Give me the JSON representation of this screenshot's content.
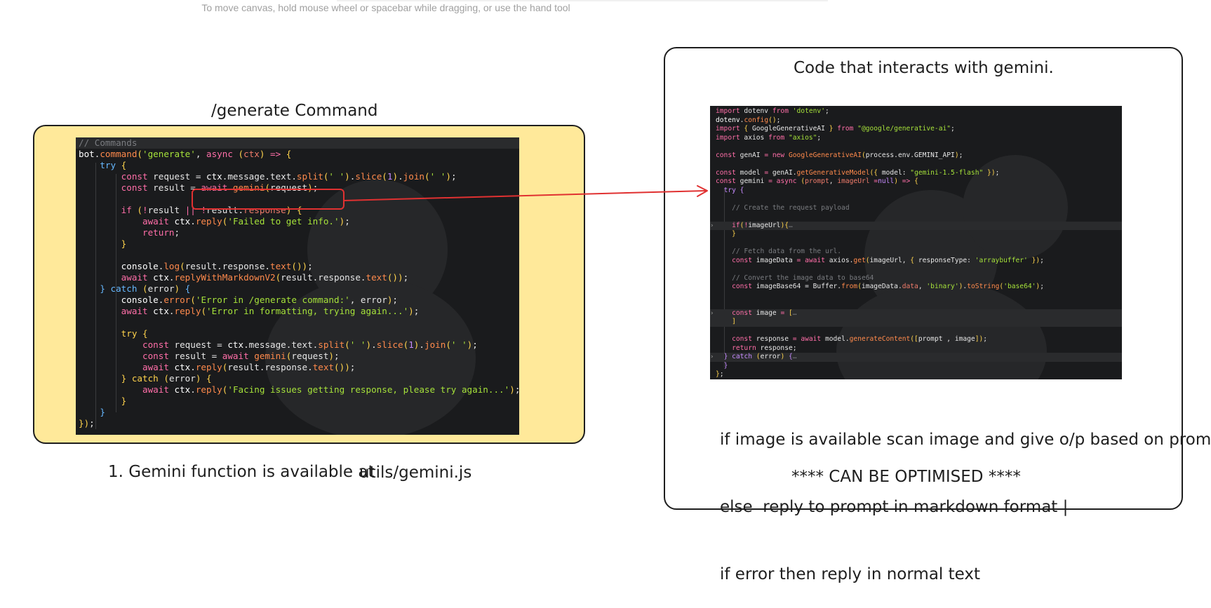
{
  "canvas_hint": "To move canvas, hold mouse wheel or spacebar while dragging, or use the hand tool",
  "left_title": "/generate Command",
  "left_note": "1. Gemini function is available at",
  "left_note_path": "utils/gemini.js",
  "right_title": "Code that interacts with gemini.",
  "right_notes": [
    "if image is available scan image and give o/p based on prompt",
    "else  reply to prompt in markdown format |",
    "if error then reply in normal text"
  ],
  "right_footer": "**** CAN BE OPTIMISED ****",
  "colors": {
    "frame_fill": "#ffe99a",
    "arrow": "#e03131",
    "code_bg": "#1a1b1d"
  },
  "left_code": [
    [
      [
        "c",
        "// Commands"
      ]
    ],
    [
      [
        "v",
        "bot"
      ],
      [
        "",
        "."
      ],
      [
        "f",
        "command"
      ],
      [
        "p",
        "("
      ],
      [
        "s",
        "'generate'"
      ],
      [
        "",
        ", "
      ],
      [
        "k",
        "async"
      ],
      [
        "p",
        " ("
      ],
      [
        "pr",
        "ctx"
      ],
      [
        "p",
        ")"
      ],
      [
        "k",
        " => "
      ],
      [
        "p",
        "{"
      ]
    ],
    [
      [
        "",
        "    "
      ],
      [
        "b",
        "try"
      ],
      [
        "p",
        " {"
      ]
    ],
    [
      [
        "",
        "        "
      ],
      [
        "k",
        "const"
      ],
      [
        "",
        " request = "
      ],
      [
        "v",
        "ctx"
      ],
      [
        "",
        ".message.text."
      ],
      [
        "f",
        "split"
      ],
      [
        "p",
        "("
      ],
      [
        "s",
        "' '"
      ],
      [
        "p",
        ")"
      ],
      [
        "",
        "."
      ],
      [
        "f",
        "slice"
      ],
      [
        "p",
        "("
      ],
      [
        "pu",
        "1"
      ],
      [
        "p",
        ")"
      ],
      [
        "",
        "."
      ],
      [
        "f",
        "join"
      ],
      [
        "p",
        "("
      ],
      [
        "s",
        "' '"
      ],
      [
        "p",
        ")"
      ],
      [
        "",
        ";"
      ]
    ],
    [
      [
        "",
        "        "
      ],
      [
        "k",
        "const"
      ],
      [
        "",
        " result = "
      ],
      [
        "k",
        "await "
      ],
      [
        "f",
        "gemini"
      ],
      [
        "p",
        "("
      ],
      [
        "",
        "request"
      ],
      [
        "p",
        ")"
      ],
      [
        "",
        ";"
      ]
    ],
    [
      [
        "",
        ""
      ]
    ],
    [
      [
        "",
        "        "
      ],
      [
        "k",
        "if"
      ],
      [
        "p",
        " ("
      ],
      [
        "k",
        "!"
      ],
      [
        "",
        "result "
      ],
      [
        "k",
        "||"
      ],
      [
        "k",
        " !"
      ],
      [
        "",
        "result."
      ],
      [
        "pr",
        "response"
      ],
      [
        "p",
        ")"
      ],
      [
        "p",
        " {"
      ]
    ],
    [
      [
        "",
        "            "
      ],
      [
        "k",
        "await "
      ],
      [
        "v",
        "ctx"
      ],
      [
        "",
        "."
      ],
      [
        "f",
        "reply"
      ],
      [
        "p",
        "("
      ],
      [
        "s",
        "'Failed to get info.'"
      ],
      [
        "p",
        ")"
      ],
      [
        "",
        ";"
      ]
    ],
    [
      [
        "",
        "            "
      ],
      [
        "k",
        "return"
      ],
      [
        "",
        ";"
      ]
    ],
    [
      [
        "",
        "        "
      ],
      [
        "p",
        "}"
      ]
    ],
    [
      [
        "",
        ""
      ]
    ],
    [
      [
        "",
        "        "
      ],
      [
        "v",
        "console"
      ],
      [
        "",
        "."
      ],
      [
        "f",
        "log"
      ],
      [
        "p",
        "("
      ],
      [
        "",
        "result.response."
      ],
      [
        "f",
        "text"
      ],
      [
        "p",
        "()"
      ],
      [
        "p",
        ")"
      ],
      [
        "",
        ";"
      ]
    ],
    [
      [
        "",
        "        "
      ],
      [
        "k",
        "await "
      ],
      [
        "v",
        "ctx"
      ],
      [
        "",
        "."
      ],
      [
        "f",
        "replyWithMarkdownV2"
      ],
      [
        "p",
        "("
      ],
      [
        "",
        "result.response."
      ],
      [
        "f",
        "text"
      ],
      [
        "p",
        "()"
      ],
      [
        "p",
        ")"
      ],
      [
        "",
        ";"
      ]
    ],
    [
      [
        "",
        "    "
      ],
      [
        "b",
        "}"
      ],
      [
        "b",
        " catch"
      ],
      [
        "p",
        " ("
      ],
      [
        "",
        "error"
      ],
      [
        "p",
        ")"
      ],
      [
        "b",
        " {"
      ]
    ],
    [
      [
        "",
        "        "
      ],
      [
        "v",
        "console"
      ],
      [
        "",
        "."
      ],
      [
        "f",
        "error"
      ],
      [
        "p",
        "("
      ],
      [
        "s",
        "'Error in /generate command:'"
      ],
      [
        "",
        ", error"
      ],
      [
        "p",
        ")"
      ],
      [
        "",
        ";"
      ]
    ],
    [
      [
        "",
        "        "
      ],
      [
        "k",
        "await "
      ],
      [
        "v",
        "ctx"
      ],
      [
        "",
        "."
      ],
      [
        "f",
        "reply"
      ],
      [
        "p",
        "("
      ],
      [
        "s",
        "'Error in formatting, trying again...'"
      ],
      [
        "p",
        ")"
      ],
      [
        "",
        ";"
      ]
    ],
    [
      [
        "",
        ""
      ]
    ],
    [
      [
        "",
        "        "
      ],
      [
        "p",
        "try"
      ],
      [
        "p",
        " {"
      ]
    ],
    [
      [
        "",
        "            "
      ],
      [
        "k",
        "const"
      ],
      [
        "",
        " request = "
      ],
      [
        "v",
        "ctx"
      ],
      [
        "",
        ".message.text."
      ],
      [
        "f",
        "split"
      ],
      [
        "p",
        "("
      ],
      [
        "s",
        "' '"
      ],
      [
        "p",
        ")"
      ],
      [
        "",
        "."
      ],
      [
        "f",
        "slice"
      ],
      [
        "p",
        "("
      ],
      [
        "pu",
        "1"
      ],
      [
        "p",
        ")"
      ],
      [
        "",
        "."
      ],
      [
        "f",
        "join"
      ],
      [
        "p",
        "("
      ],
      [
        "s",
        "' '"
      ],
      [
        "p",
        ")"
      ],
      [
        "",
        ";"
      ]
    ],
    [
      [
        "",
        "            "
      ],
      [
        "k",
        "const"
      ],
      [
        "",
        " result = "
      ],
      [
        "k",
        "await "
      ],
      [
        "f",
        "gemini"
      ],
      [
        "p",
        "("
      ],
      [
        "",
        "request"
      ],
      [
        "p",
        ")"
      ],
      [
        "",
        ";"
      ]
    ],
    [
      [
        "",
        "            "
      ],
      [
        "k",
        "await "
      ],
      [
        "v",
        "ctx"
      ],
      [
        "",
        "."
      ],
      [
        "f",
        "reply"
      ],
      [
        "p",
        "("
      ],
      [
        "",
        "result.response."
      ],
      [
        "f",
        "text"
      ],
      [
        "p",
        "()"
      ],
      [
        "p",
        ")"
      ],
      [
        "",
        ";"
      ]
    ],
    [
      [
        "",
        "        "
      ],
      [
        "p",
        "}"
      ],
      [
        "p",
        " catch"
      ],
      [
        "p",
        " ("
      ],
      [
        "",
        "error"
      ],
      [
        "p",
        ")"
      ],
      [
        "p",
        " {"
      ]
    ],
    [
      [
        "",
        "            "
      ],
      [
        "k",
        "await "
      ],
      [
        "v",
        "ctx"
      ],
      [
        "",
        "."
      ],
      [
        "f",
        "reply"
      ],
      [
        "p",
        "("
      ],
      [
        "s",
        "'Facing issues getting response, please try again...'"
      ],
      [
        "p",
        ")"
      ],
      [
        "",
        ";"
      ]
    ],
    [
      [
        "",
        "        "
      ],
      [
        "p",
        "}"
      ]
    ],
    [
      [
        "",
        "    "
      ],
      [
        "b",
        "}"
      ]
    ],
    [
      [
        "p",
        "})"
      ],
      [
        "",
        ";"
      ]
    ]
  ],
  "right_code": [
    [
      [
        "k",
        "import"
      ],
      [
        "",
        " dotenv "
      ],
      [
        "k",
        "from"
      ],
      [
        "s",
        " 'dotenv'"
      ],
      [
        "",
        ";"
      ]
    ],
    [
      [
        "v",
        "dotenv"
      ],
      [
        "",
        "."
      ],
      [
        "f",
        "config"
      ],
      [
        "p",
        "()"
      ],
      [
        "",
        ";"
      ]
    ],
    [
      [
        "k",
        "import"
      ],
      [
        "p",
        " { "
      ],
      [
        "",
        "GoogleGenerativeAI "
      ],
      [
        "p",
        "}"
      ],
      [
        "k",
        " from"
      ],
      [
        "s",
        " \"@google/generative-ai\""
      ],
      [
        "",
        ";"
      ]
    ],
    [
      [
        "k",
        "import"
      ],
      [
        "",
        " axios "
      ],
      [
        "k",
        "from"
      ],
      [
        "s",
        " \"axios\""
      ],
      [
        "",
        ";"
      ]
    ],
    [
      [
        "",
        ""
      ]
    ],
    [
      [
        "k",
        "const"
      ],
      [
        "",
        " genAI "
      ],
      [
        "k",
        "="
      ],
      [
        "k",
        " new "
      ],
      [
        "f",
        "GoogleGenerativeAI"
      ],
      [
        "p",
        "("
      ],
      [
        "",
        "process.env.GEMINI_API"
      ],
      [
        "p",
        ")"
      ],
      [
        "",
        ";"
      ]
    ],
    [
      [
        "",
        ""
      ]
    ],
    [
      [
        "k",
        "const"
      ],
      [
        "",
        " model "
      ],
      [
        "k",
        "="
      ],
      [
        "",
        " genAI."
      ],
      [
        "f",
        "getGenerativeModel"
      ],
      [
        "p",
        "({"
      ],
      [
        "",
        " model: "
      ],
      [
        "s",
        "\"gemini-1.5-flash\""
      ],
      [
        "p",
        " })"
      ],
      [
        "",
        ";"
      ]
    ],
    [
      [
        "k",
        "const"
      ],
      [
        "",
        " gemini "
      ],
      [
        "k",
        "="
      ],
      [
        "k",
        " async"
      ],
      [
        "p",
        " ("
      ],
      [
        "pr",
        "prompt"
      ],
      [
        "",
        ", "
      ],
      [
        "pr",
        "imageUrl"
      ],
      [
        "k",
        " ="
      ],
      [
        "pu",
        "null"
      ],
      [
        "p",
        ")"
      ],
      [
        "k",
        " =>"
      ],
      [
        "p",
        " {"
      ]
    ],
    [
      [
        "",
        "  "
      ],
      [
        "pu",
        "try"
      ],
      [
        "pu",
        " {"
      ]
    ],
    [
      [
        "",
        ""
      ]
    ],
    [
      [
        "",
        "    "
      ],
      [
        "c",
        "// Create the request payload"
      ]
    ],
    [
      [
        "",
        ""
      ]
    ],
    [
      [
        "",
        "    "
      ],
      [
        "k",
        "if"
      ],
      [
        "p",
        "("
      ],
      [
        "k",
        "!"
      ],
      [
        "",
        "imageUrl"
      ],
      [
        "p",
        ")"
      ],
      [
        "p",
        "{"
      ],
      [
        "c",
        "…"
      ]
    ],
    [
      [
        "",
        "    "
      ],
      [
        "p",
        "}"
      ]
    ],
    [
      [
        "",
        ""
      ]
    ],
    [
      [
        "",
        "    "
      ],
      [
        "c",
        "// Fetch data from the url."
      ]
    ],
    [
      [
        "",
        "    "
      ],
      [
        "k",
        "const"
      ],
      [
        "",
        " imageData "
      ],
      [
        "k",
        "="
      ],
      [
        "k",
        " await"
      ],
      [
        "",
        " axios."
      ],
      [
        "f",
        "get"
      ],
      [
        "p",
        "("
      ],
      [
        "",
        "imageUrl, "
      ],
      [
        "p",
        "{"
      ],
      [
        "",
        " responseType: "
      ],
      [
        "s",
        "'arraybuffer'"
      ],
      [
        "p",
        " })"
      ],
      [
        "",
        ";"
      ]
    ],
    [
      [
        "",
        ""
      ]
    ],
    [
      [
        "",
        "    "
      ],
      [
        "c",
        "// Convert the image data to base64"
      ]
    ],
    [
      [
        "",
        "    "
      ],
      [
        "k",
        "const"
      ],
      [
        "",
        " imageBase64 = Buffer."
      ],
      [
        "f",
        "from"
      ],
      [
        "p",
        "("
      ],
      [
        "",
        "imageData."
      ],
      [
        "pr",
        "data"
      ],
      [
        "",
        ", "
      ],
      [
        "s",
        "'binary'"
      ],
      [
        "p",
        ")"
      ],
      [
        "",
        "."
      ],
      [
        "f",
        "toString"
      ],
      [
        "p",
        "("
      ],
      [
        "s",
        "'base64'"
      ],
      [
        "p",
        ")"
      ],
      [
        "",
        ";"
      ]
    ],
    [
      [
        "",
        ""
      ]
    ],
    [
      [
        "",
        ""
      ]
    ],
    [
      [
        "",
        "    "
      ],
      [
        "k",
        "const"
      ],
      [
        "",
        " image "
      ],
      [
        "k",
        "="
      ],
      [
        "p",
        " ["
      ],
      [
        "c",
        "…"
      ]
    ],
    [
      [
        "",
        "    "
      ],
      [
        "p",
        "]"
      ]
    ],
    [
      [
        "",
        ""
      ]
    ],
    [
      [
        "",
        "    "
      ],
      [
        "k",
        "const"
      ],
      [
        "",
        " response "
      ],
      [
        "k",
        "="
      ],
      [
        "k",
        " await"
      ],
      [
        "",
        " model."
      ],
      [
        "f",
        "generateContent"
      ],
      [
        "p",
        "(["
      ],
      [
        "",
        "prompt , image"
      ],
      [
        "p",
        "])"
      ],
      [
        "",
        ";"
      ]
    ],
    [
      [
        "",
        "    "
      ],
      [
        "k",
        "return"
      ],
      [
        "",
        " response;"
      ]
    ],
    [
      [
        "",
        "  "
      ],
      [
        "pu",
        "}"
      ],
      [
        "pu",
        " catch"
      ],
      [
        "p",
        " ("
      ],
      [
        "",
        "error"
      ],
      [
        "p",
        ")"
      ],
      [
        "pu",
        " {"
      ],
      [
        "c",
        "…"
      ]
    ],
    [
      [
        "",
        "  "
      ],
      [
        "pu",
        "}"
      ]
    ],
    [
      [
        "p",
        "}"
      ],
      [
        "",
        ";"
      ]
    ]
  ]
}
